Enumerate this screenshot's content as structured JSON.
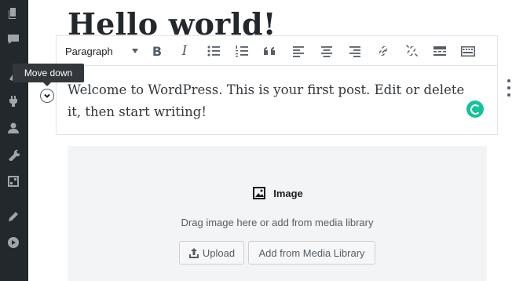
{
  "sidebar": {
    "icons": [
      "pages-icon",
      "comments-icon",
      "appearance-icon",
      "plugins-icon",
      "users-icon",
      "tools-icon",
      "settings-icon",
      "edit-icon",
      "play-icon"
    ]
  },
  "post": {
    "title": "Hello world!"
  },
  "paragraph_block": {
    "toolbar": {
      "block_type": "Paragraph",
      "buttons": [
        "bold-button",
        "italic-button",
        "bulleted-list-button",
        "numbered-list-button",
        "quote-button",
        "align-left-button",
        "align-center-button",
        "align-right-button",
        "link-button",
        "unlink-button",
        "more-button",
        "toolbar-toggle-button"
      ]
    },
    "content": "Welcome to WordPress. This is your first post. Edit or delete it, then start writing!"
  },
  "mover": {
    "tooltip": "Move down"
  },
  "image_block": {
    "label": "Image",
    "instructions": "Drag image here or add from media library",
    "upload_label": "Upload",
    "media_library_label": "Add from Media Library"
  }
}
